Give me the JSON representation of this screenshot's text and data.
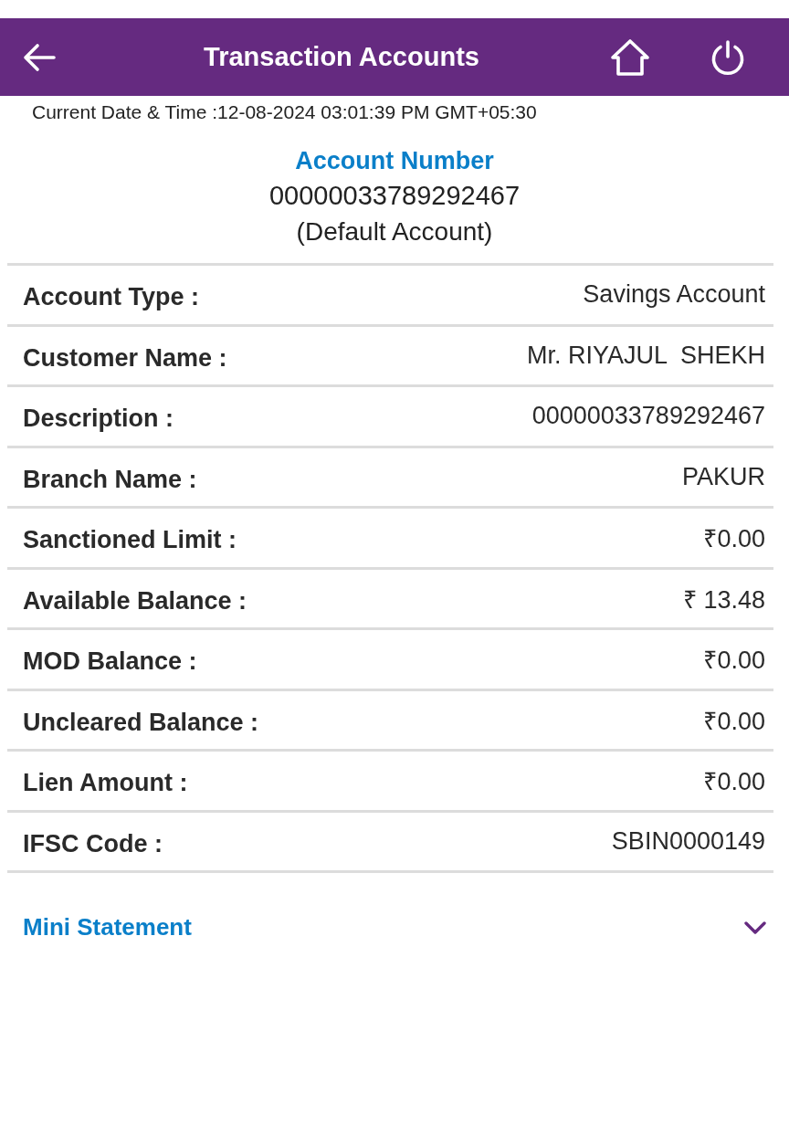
{
  "header": {
    "title": "Transaction Accounts"
  },
  "date_time": "Current Date & Time :12-08-2024 03:01:39 PM GMT+05:30",
  "account": {
    "heading": "Account Number",
    "number": "00000033789292467",
    "note": "(Default Account)"
  },
  "details": [
    {
      "label": "Account Type :",
      "value": "Savings Account"
    },
    {
      "label": "Customer Name :",
      "value": "Mr. RIYAJUL  SHEKH"
    },
    {
      "label": "Description :",
      "value": "00000033789292467"
    },
    {
      "label": "Branch Name :",
      "value": "PAKUR"
    },
    {
      "label": "Sanctioned Limit :",
      "value": "₹0.00"
    },
    {
      "label": "Available Balance :",
      "value": "₹ 13.48"
    },
    {
      "label": "MOD Balance :",
      "value": "₹0.00"
    },
    {
      "label": "Uncleared Balance :",
      "value": "₹0.00"
    },
    {
      "label": "Lien Amount :",
      "value": "₹0.00"
    },
    {
      "label": "IFSC Code :",
      "value": "SBIN0000149"
    }
  ],
  "mini_statement": {
    "label": "Mini Statement",
    "expanded": false
  }
}
